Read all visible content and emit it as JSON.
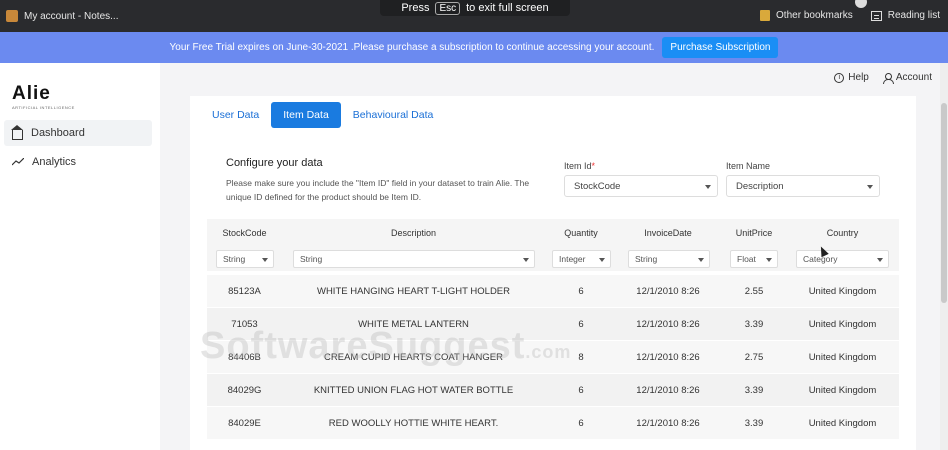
{
  "browser": {
    "tab_title": "My account - Notes...",
    "fullscreen_hint_pre": "Press",
    "fullscreen_hint_key": "Esc",
    "fullscreen_hint_post": "to exit full screen",
    "bookmarks": [
      "Other bookmarks",
      "Reading list"
    ]
  },
  "banner": {
    "message": "Your Free Trial expires on June-30-2021 .Please purchase a subscription to continue accessing your account.",
    "button": "Purchase Subscription",
    "color": "#6b8af0"
  },
  "logo": {
    "name": "Alie",
    "tagline": "ARTIFICIAL INTELLIGENCE"
  },
  "sidebar": {
    "items": [
      {
        "label": "Dashboard",
        "icon": "home-icon",
        "active": true
      },
      {
        "label": "Analytics",
        "icon": "trend-icon",
        "active": false
      }
    ]
  },
  "header": {
    "help": "Help",
    "account": "Account"
  },
  "tabs": [
    {
      "label": "User Data",
      "active": false
    },
    {
      "label": "Item Data",
      "active": true
    },
    {
      "label": "Behavioural Data",
      "active": false
    }
  ],
  "config": {
    "title": "Configure your data",
    "description": "Please make sure you include the \"Item ID\" field in your dataset to train Alie. The unique ID defined for the product should be Item ID.",
    "item_id_label": "Item Id",
    "item_id_required": "*",
    "item_id_value": "StockCode",
    "item_name_label": "Item Name",
    "item_name_value": "Description"
  },
  "table": {
    "columns": [
      {
        "header": "StockCode",
        "type": "String"
      },
      {
        "header": "Description",
        "type": "String"
      },
      {
        "header": "Quantity",
        "type": "Integer"
      },
      {
        "header": "InvoiceDate",
        "type": "String"
      },
      {
        "header": "UnitPrice",
        "type": "Float"
      },
      {
        "header": "Country",
        "type": "Category"
      }
    ],
    "rows": [
      [
        "85123A",
        "WHITE HANGING HEART T-LIGHT HOLDER",
        "6",
        "12/1/2010 8:26",
        "2.55",
        "United Kingdom"
      ],
      [
        "71053",
        "WHITE METAL LANTERN",
        "6",
        "12/1/2010 8:26",
        "3.39",
        "United Kingdom"
      ],
      [
        "84406B",
        "CREAM CUPID HEARTS COAT HANGER",
        "8",
        "12/1/2010 8:26",
        "2.75",
        "United Kingdom"
      ],
      [
        "84029G",
        "KNITTED UNION FLAG HOT WATER BOTTLE",
        "6",
        "12/1/2010 8:26",
        "3.39",
        "United Kingdom"
      ],
      [
        "84029E",
        "RED WOOLLY HOTTIE WHITE HEART.",
        "6",
        "12/1/2010 8:26",
        "3.39",
        "United Kingdom"
      ]
    ]
  },
  "watermark": {
    "main": "SoftwareSuggest",
    "suffix": ".com"
  }
}
